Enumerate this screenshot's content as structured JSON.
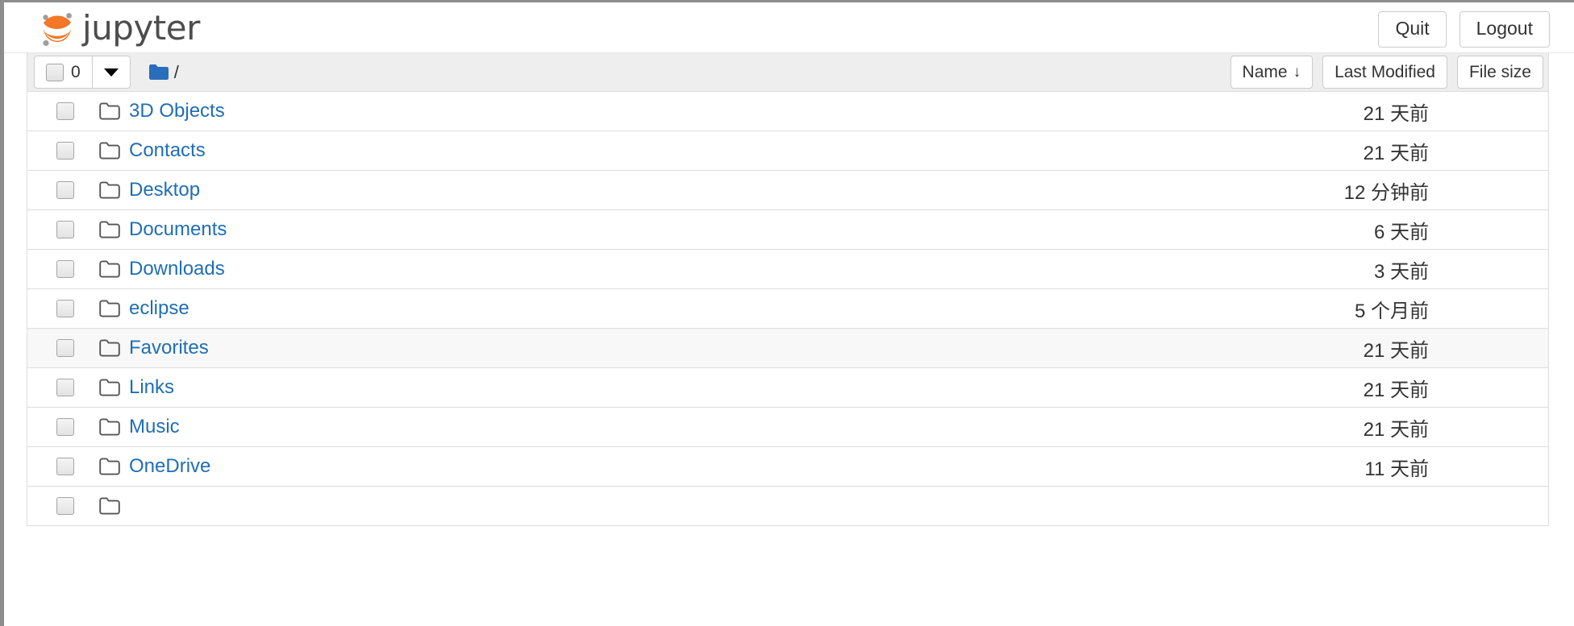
{
  "header": {
    "brand": "jupyter",
    "logo_icon": "jupyter-logo",
    "buttons": [
      {
        "label": "Quit",
        "name": "quit-button"
      },
      {
        "label": "Logout",
        "name": "logout-button"
      }
    ]
  },
  "toolbar": {
    "selection_count": "0",
    "select_all_checkbox_state": "unchecked",
    "dropdown_icon": "caret-down-icon",
    "breadcrumb": {
      "folder_icon": "folder-icon",
      "path": "/"
    },
    "sort_buttons": [
      {
        "label": "Name",
        "arrow": "↓",
        "name": "sort-by-name-button",
        "active": true
      },
      {
        "label": "Last Modified",
        "arrow": "",
        "name": "sort-by-last-modified-button",
        "active": false
      },
      {
        "label": "File size",
        "arrow": "",
        "name": "sort-by-file-size-button",
        "active": false
      }
    ]
  },
  "colors": {
    "link": "#1f6eb5",
    "brand_orange": "#f37726",
    "brand_gray": "#9e9e9e",
    "toolbar_bg": "#eeeeee",
    "row_border": "#dddddd",
    "row_hover": "#f8f8f8",
    "text": "#333333"
  },
  "file_list": {
    "columns": [
      "Name",
      "Last Modified",
      "File size"
    ],
    "items": [
      {
        "name": "3D Objects",
        "icon": "folder-icon",
        "modified": "21 天前",
        "size": "",
        "hovered": false
      },
      {
        "name": "Contacts",
        "icon": "folder-icon",
        "modified": "21 天前",
        "size": "",
        "hovered": false
      },
      {
        "name": "Desktop",
        "icon": "folder-icon",
        "modified": "12 分钟前",
        "size": "",
        "hovered": false
      },
      {
        "name": "Documents",
        "icon": "folder-icon",
        "modified": "6 天前",
        "size": "",
        "hovered": false
      },
      {
        "name": "Downloads",
        "icon": "folder-icon",
        "modified": "3 天前",
        "size": "",
        "hovered": false
      },
      {
        "name": "eclipse",
        "icon": "folder-icon",
        "modified": "5 个月前",
        "size": "",
        "hovered": false
      },
      {
        "name": "Favorites",
        "icon": "folder-icon",
        "modified": "21 天前",
        "size": "",
        "hovered": true
      },
      {
        "name": "Links",
        "icon": "folder-icon",
        "modified": "21 天前",
        "size": "",
        "hovered": false
      },
      {
        "name": "Music",
        "icon": "folder-icon",
        "modified": "21 天前",
        "size": "",
        "hovered": false
      },
      {
        "name": "OneDrive",
        "icon": "folder-icon",
        "modified": "11 天前",
        "size": "",
        "hovered": false
      },
      {
        "name": "",
        "icon": "folder-icon",
        "modified": "",
        "size": "",
        "hovered": false
      }
    ]
  }
}
